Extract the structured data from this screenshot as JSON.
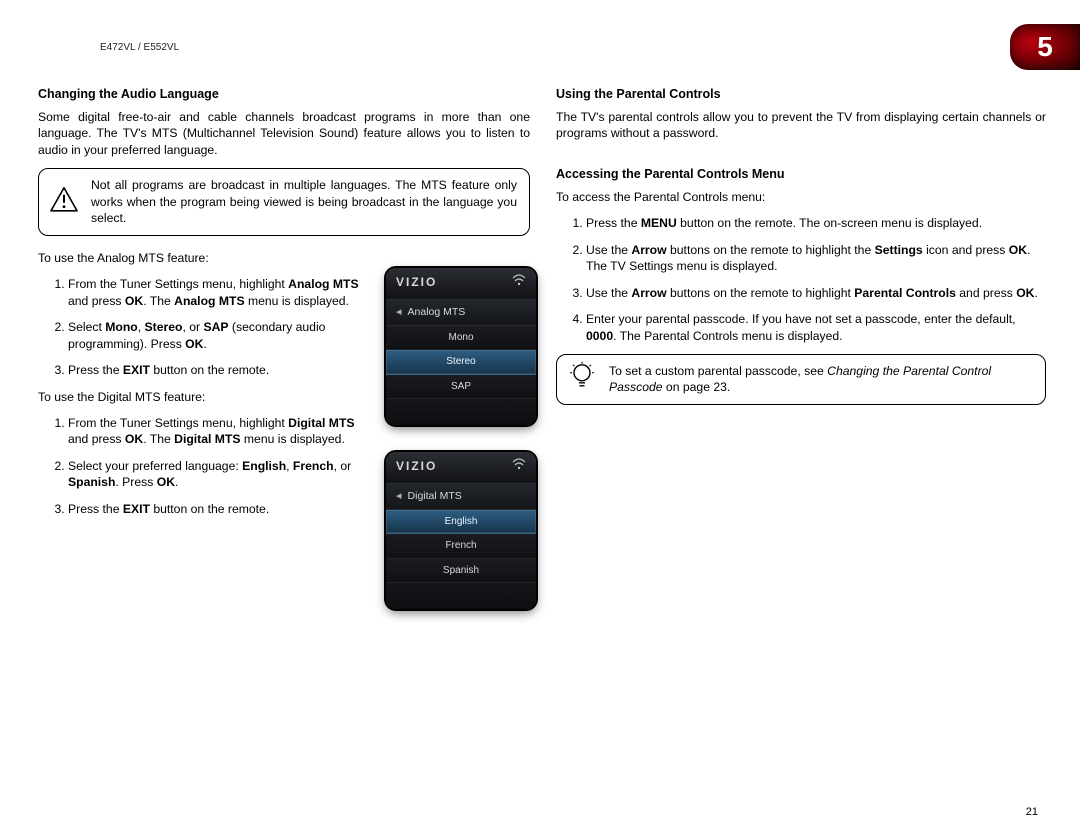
{
  "header": {
    "model": "E472VL / E552VL",
    "chapter": "5"
  },
  "page_number": "21",
  "left": {
    "h_audio": "Changing the Audio Language",
    "p_intro": "Some digital free-to-air and cable channels broadcast programs in more than one language. The TV's MTS (Multichannel Television Sound) feature allows you to listen to audio in your preferred language.",
    "note_mts": "Not all programs are broadcast in multiple languages. The MTS feature only works when the program being viewed is being broadcast in the language you select.",
    "p_analog_lead": "To use the Analog MTS feature:",
    "analog_steps_html": [
      "From the Tuner Settings menu, highlight <b>Analog MTS</b> and press <b>OK</b>. The <b>Analog MTS</b> menu is displayed.",
      "Select <b>Mono</b>, <b>Stereo</b>, or <b>SAP</b> (secondary audio programming). Press <b>OK</b>.",
      "Press the <b>EXIT</b> button on the remote."
    ],
    "p_digital_lead": "To use the Digital MTS feature:",
    "digital_steps_html": [
      "From the Tuner Settings menu, highlight <b>Digital MTS</b> and press <b>OK</b>. The <b>Digital MTS</b> menu is displayed.",
      "Select your preferred language: <b>English</b>, <b>French</b>, or <b>Spanish</b>. Press <b>OK</b>.",
      "Press the <b>EXIT</b> button on the remote."
    ],
    "menu_analog": {
      "brand": "VIZIO",
      "crumb": "Analog MTS",
      "opts": [
        "Mono",
        "Stereo",
        "SAP"
      ],
      "selected": 1
    },
    "menu_digital": {
      "brand": "VIZIO",
      "crumb": "Digital MTS",
      "opts": [
        "English",
        "French",
        "Spanish"
      ],
      "selected": 0
    }
  },
  "right": {
    "h_parental": "Using the Parental Controls",
    "p_parental": "The TV's parental controls allow you to prevent the TV from displaying certain channels or programs without a password.",
    "h_access": "Accessing the Parental Controls Menu",
    "p_access_lead": "To access the Parental Controls menu:",
    "access_steps_html": [
      "Press the <b>MENU</b> button on the remote. The on-screen menu is displayed.",
      "Use the <b>Arrow</b> buttons on the remote to highlight the <b>Settings</b> icon and press <b>OK</b>. The TV Settings menu is displayed.",
      "Use the <b>Arrow</b> buttons on the remote to highlight <b>Parental Controls</b> and press <b>OK</b>.",
      "Enter your parental passcode. If you have not set a passcode, enter the default, <b>0000</b>. The Parental Controls menu is displayed."
    ],
    "tip_html": "To set a custom parental passcode, see <i>Changing the Parental Control Passcode</i> on page 23."
  }
}
